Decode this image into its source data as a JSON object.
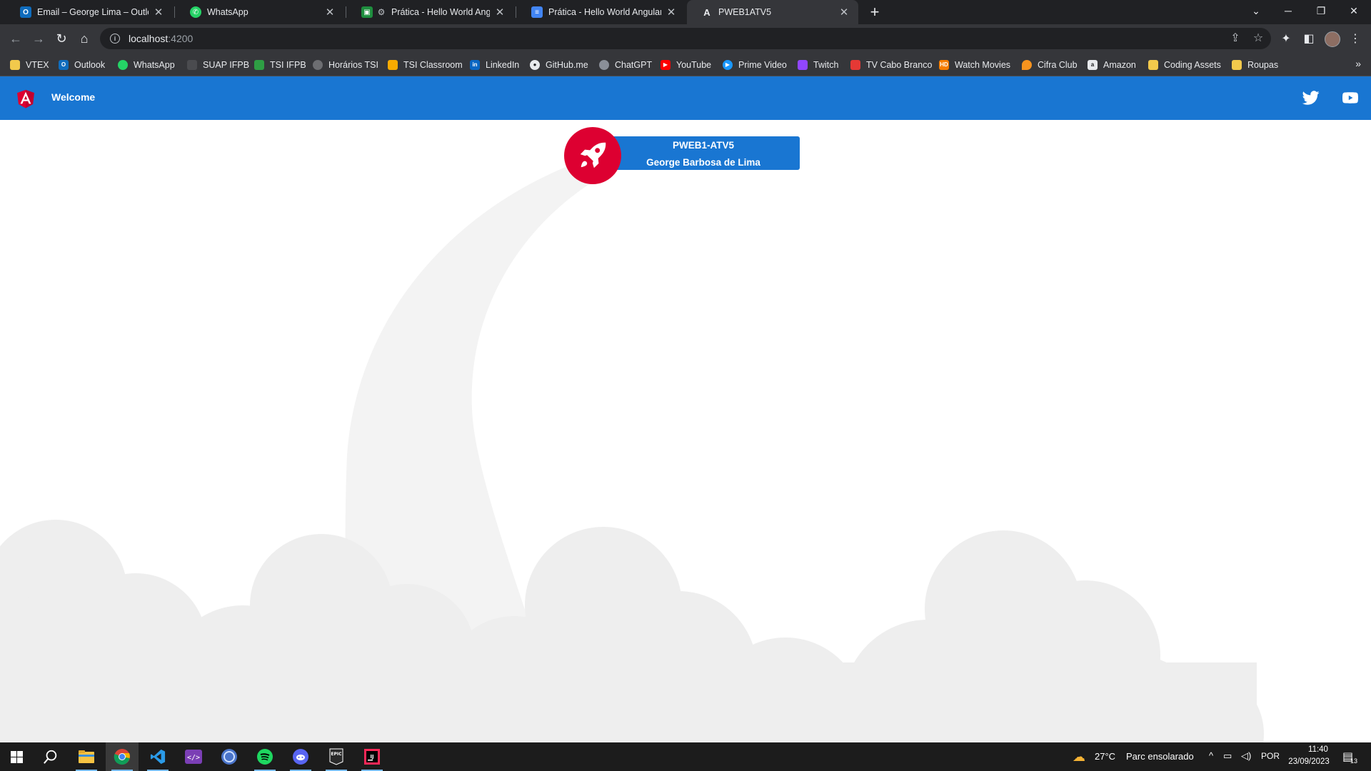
{
  "browser": {
    "tabs": [
      {
        "label": "Email – George Lima – Outlook",
        "icon": "outlook-icon",
        "color": "#0f6cbd"
      },
      {
        "label": "WhatsApp",
        "icon": "whatsapp-icon",
        "color": "#25d366"
      },
      {
        "label": "Prática - Hello World Angular",
        "icon": "classroom-icon",
        "color": "#1e8e3e"
      },
      {
        "label": "Prática - Hello World Angular - D",
        "icon": "docs-icon",
        "color": "#4285f4"
      },
      {
        "label": "PWEB1ATV5",
        "icon": "angular-icon",
        "color": "#35363a"
      }
    ],
    "active_tab": 4,
    "url_host": "localhost",
    "url_port": ":4200",
    "bookmarks": [
      {
        "label": "VTEX",
        "icon": "folder-icon",
        "color": "#f2c94c"
      },
      {
        "label": "Outlook",
        "icon": "outlook-icon",
        "color": "#0f6cbd"
      },
      {
        "label": "WhatsApp",
        "icon": "whatsapp-icon",
        "color": "#25d366"
      },
      {
        "label": "SUAP IFPB",
        "icon": "suap-icon",
        "color": "#4a4b4f"
      },
      {
        "label": "TSI IFPB",
        "icon": "ifpb-icon",
        "color": "#2e9e44"
      },
      {
        "label": "Horários TSI",
        "icon": "globe-icon",
        "color": "#6d6e72"
      },
      {
        "label": "TSI Classroom",
        "icon": "classroom-icon",
        "color": "#f9ab00"
      },
      {
        "label": "LinkedIn",
        "icon": "linkedin-icon",
        "color": "#0a66c2"
      },
      {
        "label": "GitHub.me",
        "icon": "github-icon",
        "color": "#e8eaed"
      },
      {
        "label": "ChatGPT",
        "icon": "chatgpt-icon",
        "color": "#8a8f98"
      },
      {
        "label": "YouTube",
        "icon": "youtube-icon",
        "color": "#ff0000"
      },
      {
        "label": "Prime Video",
        "icon": "prime-video-icon",
        "color": "#1a98ff"
      },
      {
        "label": "Twitch",
        "icon": "twitch-icon",
        "color": "#9146ff"
      },
      {
        "label": "TV Cabo Branco",
        "icon": "tv-cabo-branco-icon",
        "color": "#e53935"
      },
      {
        "label": "Watch Movies",
        "icon": "hd-icon",
        "color": "#f57c00"
      },
      {
        "label": "Cifra Club",
        "icon": "cifra-club-icon",
        "color": "#f7931e"
      },
      {
        "label": "Amazon",
        "icon": "amazon-icon",
        "color": "#e8eaed"
      },
      {
        "label": "Coding Assets",
        "icon": "folder-icon",
        "color": "#f2c94c"
      },
      {
        "label": "Roupas",
        "icon": "folder-icon",
        "color": "#f2c94c"
      }
    ]
  },
  "app": {
    "toolbar_title": "Welcome",
    "card_line1": "PWEB1-ATV5",
    "card_line2": "George Barbosa de Lima",
    "brand_color": "#1976d2",
    "accent_color": "#dd0031"
  },
  "taskbar": {
    "apps": [
      "windows-start-icon",
      "search-icon",
      "file-explorer-icon",
      "chrome-icon",
      "vscode-icon",
      "devtools-icon",
      "app-icon",
      "spotify-icon",
      "discord-icon",
      "epic-games-icon",
      "intellij-icon"
    ],
    "weather_temp": "27°C",
    "weather_text": "Parc ensolarado",
    "language": "POR",
    "time": "11:40",
    "date": "23/09/2023",
    "notification_count": "13"
  }
}
